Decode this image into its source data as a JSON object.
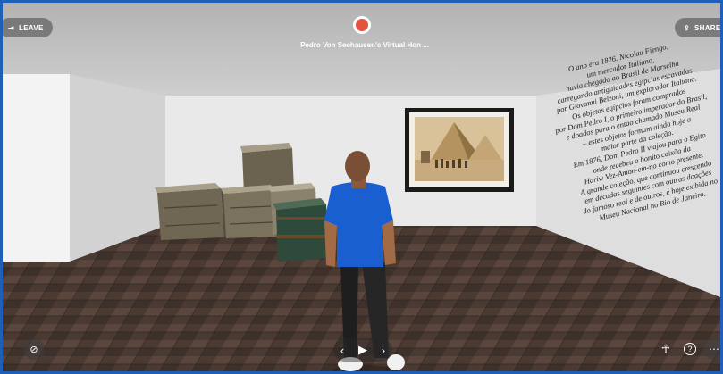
{
  "header": {
    "leave_label": "LEAVE",
    "share_label": "SHARE",
    "room_title": "Pedro Von Seehausen's Virtual Hon ..."
  },
  "wall_text": {
    "lines": [
      "O ano era 1826. Nicolau Fiengo,",
      "um mercador Italiano,",
      "havia chegado ao Brasil de Marselha",
      "carregando antiguidades egípcias escavadas",
      "por Giovanni Belzoni, um explorador Italiano.",
      "Os objetos egípcios foram comprados",
      "por Dom Pedro I, o primeiro imperador do Brasil,",
      "e doados para o então chamado Museu Real",
      "— estes objetos formam ainda hoje a",
      "maior parte da coleção.",
      "Em 1876, Dom Pedro II viajou para o Egito",
      "onde recebeu o bonito caixão da",
      "Hariw Vez-Amon-em-no como presente.",
      "A grande coleção, que continuou crescendo",
      "em décadas seguintes com outras doações",
      "do famoso real e de outros, é hoje exibida no",
      "Museu Nacional no Rio de Janeiro."
    ]
  },
  "icons": {
    "leave": "exit-icon",
    "share": "share-icon",
    "host_avatar": "host-avatar",
    "camera": "camera-off-icon",
    "prev": "chevron-left-icon",
    "play": "play-icon",
    "next": "chevron-right-icon",
    "accessibility": "accessibility-icon",
    "help": "help-icon",
    "more": "more-icon"
  },
  "colors": {
    "frame": "#1f5fb8",
    "avatar_shirt": "#1a5fd0",
    "host_avatar": "#e2543f"
  }
}
